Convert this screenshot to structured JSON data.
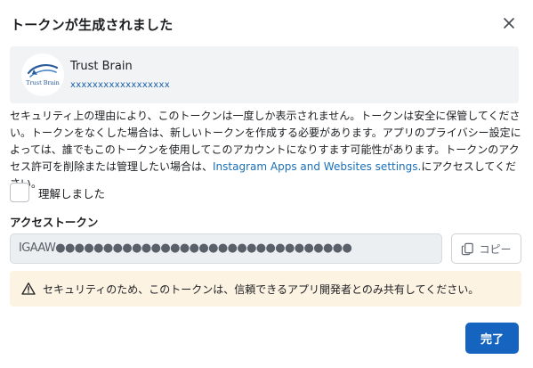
{
  "dialog": {
    "title": "トークンが生成されました"
  },
  "app": {
    "name": "Trust Brain",
    "id": "xxxxxxxxxxxxxxxxxx",
    "logo_text": "Trust Brain"
  },
  "description": {
    "text_before_link": "セキュリティ上の理由により、このトークンは一度しか表示されません。トークンは安全に保管してください。トークンをなくした場合は、新しいトークンを作成する必要があります。アプリのプライバシー設定によっては、誰でもこのトークンを使用してこのアカウントになりすます可能性があります。トークンのアクセス許可を削除または管理したい場合は、",
    "link_text": "Instagram Apps and Websites settings.",
    "text_after_link": "にアクセスしてください。"
  },
  "confirm": {
    "label": "理解しました",
    "checked": false
  },
  "token": {
    "label": "アクセストークン",
    "value": "IGAAW●●●●●●●●●●●●●●●●●●●●●●●●●●●●●●●"
  },
  "copy_button": {
    "label": "コピー"
  },
  "warning": {
    "text": "セキュリティのため、このトークンは、信頼できるアプリ開発者とのみ共有してください。",
    "color": "#fdf3e3"
  },
  "done_button": {
    "label": "完了",
    "color": "#1565c0"
  },
  "icons": {
    "close": "close-icon",
    "copy": "copy-icon",
    "warning": "warning-triangle-icon",
    "logo": "trust-brain-logo"
  }
}
